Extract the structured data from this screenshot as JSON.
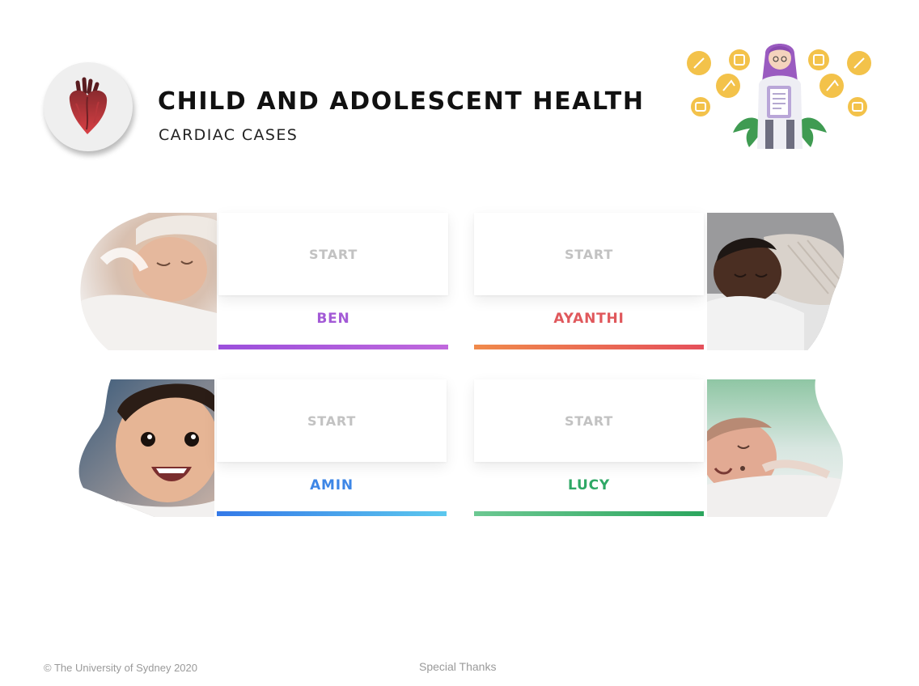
{
  "header": {
    "title": "CHILD AND ADOLESCENT HEALTH",
    "subtitle": "CARDIAC CASES",
    "logo_icon": "heart-icon",
    "illustration": "doctor-with-clipboard-illustration"
  },
  "cases": [
    {
      "name": "BEN",
      "start_label": "START",
      "name_color": "#a35ad6",
      "bar_colors": [
        "#9b4fdc",
        "#c068dd"
      ]
    },
    {
      "name": "AYANTHI",
      "start_label": "START",
      "name_color": "#e0585c",
      "bar_colors": [
        "#f08a4b",
        "#e5505b"
      ]
    },
    {
      "name": "AMIN",
      "start_label": "START",
      "name_color": "#3d86e6",
      "bar_colors": [
        "#3479e8",
        "#5cc8ee"
      ]
    },
    {
      "name": "LUCY",
      "start_label": "START",
      "name_color": "#2fa866",
      "bar_colors": [
        "#6cc892",
        "#2ca65e"
      ]
    }
  ],
  "footer": {
    "copyright": "© The University of Sydney 2020",
    "special_thanks": "Special Thanks"
  }
}
